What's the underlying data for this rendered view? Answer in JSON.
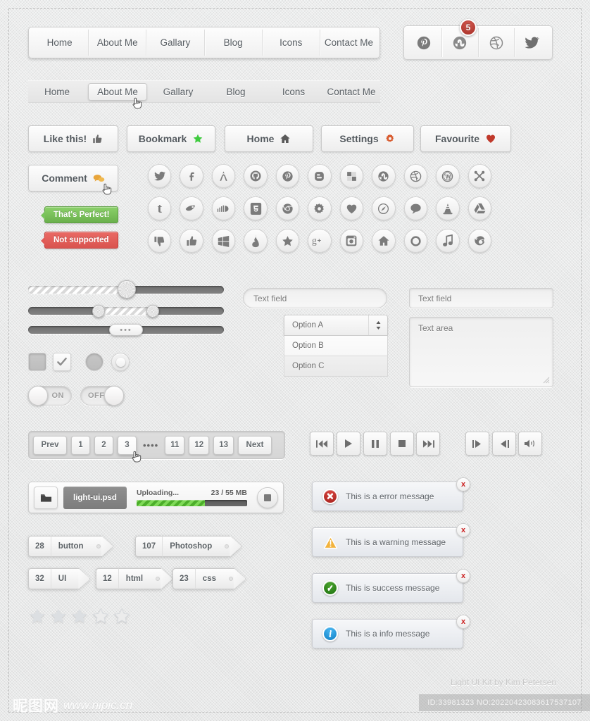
{
  "navbar1": {
    "items": [
      {
        "label": "Home"
      },
      {
        "label": "About Me"
      },
      {
        "label": "Gallary"
      },
      {
        "label": "Blog"
      },
      {
        "label": "Icons"
      },
      {
        "label": "Contact Me"
      }
    ]
  },
  "navbar2": {
    "items": [
      {
        "label": "Home",
        "active": false
      },
      {
        "label": "About Me",
        "active": true
      },
      {
        "label": "Gallary",
        "active": false
      },
      {
        "label": "Blog",
        "active": false
      },
      {
        "label": "Icons",
        "active": false
      },
      {
        "label": "Contact Me",
        "active": false
      }
    ]
  },
  "social_panel": {
    "badge_count": "5",
    "items": [
      {
        "icon": "pinterest-icon"
      },
      {
        "icon": "stumbleupon-icon"
      },
      {
        "icon": "dribbble-icon"
      },
      {
        "icon": "twitter-icon"
      }
    ]
  },
  "buttons": [
    {
      "label": "Like this!",
      "icon": "thumbs-up-icon"
    },
    {
      "label": "Bookmark",
      "icon": "star-icon"
    },
    {
      "label": "Home",
      "icon": "home-icon"
    },
    {
      "label": "Settings",
      "icon": "gear-icon"
    },
    {
      "label": "Favourite",
      "icon": "heart-icon"
    },
    {
      "label": "Comment",
      "icon": "comment-icon"
    }
  ],
  "tooltips": [
    {
      "label": "That's Perfect!",
      "color": "#6ab04c"
    },
    {
      "label": "Not supported",
      "color": "#d9534f"
    }
  ],
  "icon_grid": {
    "rows": [
      [
        "twitter-icon",
        "facebook-icon",
        "apache-icon",
        "github-icon",
        "pinterest-icon",
        "blogger-icon",
        "microsoft-icon",
        "stumbleupon-icon",
        "dribbble-icon",
        "wordpress-icon",
        "joomla-icon"
      ],
      [
        "tumblr-icon",
        "delicious-icon",
        "soundcloud-icon",
        "html5-icon",
        "chrome-icon",
        "gear-icon",
        "heart-icon",
        "compass-icon",
        "comment-icon",
        "traffic-cone-icon",
        "google-drive-icon"
      ],
      [
        "thumbs-down-icon",
        "thumbs-up-icon",
        "windows-icon",
        "fire-icon",
        "star-icon",
        "google-plus-icon",
        "instagram-icon",
        "home-icon",
        "recycle-icon",
        "music-icon",
        "firefox-icon"
      ]
    ]
  },
  "sliders": [
    {
      "name": "single-slider",
      "value": 49
    },
    {
      "name": "range-slider",
      "value_low": 36,
      "value_high": 64
    },
    {
      "name": "pill-slider",
      "value": 50,
      "handle_label": "•••"
    }
  ],
  "checkboxes": [
    {
      "name": "checkbox-unchecked",
      "checked": false
    },
    {
      "name": "checkbox-checked",
      "checked": true
    }
  ],
  "radios": [
    {
      "name": "radio-unchecked",
      "checked": false
    },
    {
      "name": "radio-checked",
      "checked": true
    }
  ],
  "toggles": [
    {
      "label": "ON",
      "state": "on"
    },
    {
      "label": "OFF",
      "state": "off"
    }
  ],
  "select": {
    "selected": "Option  A",
    "options": [
      "Option  B",
      "Option  C"
    ]
  },
  "text_fields": {
    "rounded_field": "Text field",
    "square_field": "Text field",
    "textarea": "Text area"
  },
  "pagination": {
    "prev": "Prev",
    "next": "Next",
    "pages": [
      "1",
      "2",
      "3",
      "11",
      "12",
      "13"
    ],
    "active": "3",
    "dots": "••••"
  },
  "media_controls": {
    "group1": [
      "prev-track-icon",
      "play-icon",
      "pause-icon",
      "stop-icon",
      "next-track-icon"
    ],
    "group2": [
      "step-forward-icon",
      "step-back-icon",
      "volume-icon"
    ]
  },
  "upload": {
    "folder_icon": "folder-icon",
    "filename": "light-ui.psd",
    "status": "Uploading...",
    "size": "23 / 55 MB",
    "progress": 62,
    "stop_icon": "stop-icon"
  },
  "tags": [
    {
      "count": "28",
      "label": "button",
      "has_hole": true
    },
    {
      "count": "107",
      "label": "Photoshop",
      "has_hole": true
    },
    {
      "count": "32",
      "label": "UI",
      "has_hole": false
    },
    {
      "count": "12",
      "label": "html",
      "has_hole": true
    },
    {
      "count": "23",
      "label": "css",
      "has_hole": true
    }
  ],
  "alerts": [
    {
      "text": "This is a error message",
      "type": "error",
      "icon": "error-icon",
      "color": "#c9302c",
      "close": "x"
    },
    {
      "text": "This is a warning message",
      "type": "warning",
      "icon": "warning-icon",
      "color": "#f0ad2e",
      "close": "x"
    },
    {
      "text": "This is success message",
      "type": "success",
      "icon": "success-icon",
      "color": "#2d8a1f",
      "close": "x"
    },
    {
      "text": "This is a info message",
      "type": "info",
      "icon": "info-icon",
      "color": "#29a3e8",
      "close": "x"
    }
  ],
  "rating": {
    "filled": 3,
    "total": 5
  },
  "footer": {
    "credit": "Light UI Kit by Kim Petersen",
    "stock_id": "ID:33981323 NO:20220423083617537107",
    "watermark_cn": "昵图网",
    "watermark_url": "www.nipic.cn"
  }
}
